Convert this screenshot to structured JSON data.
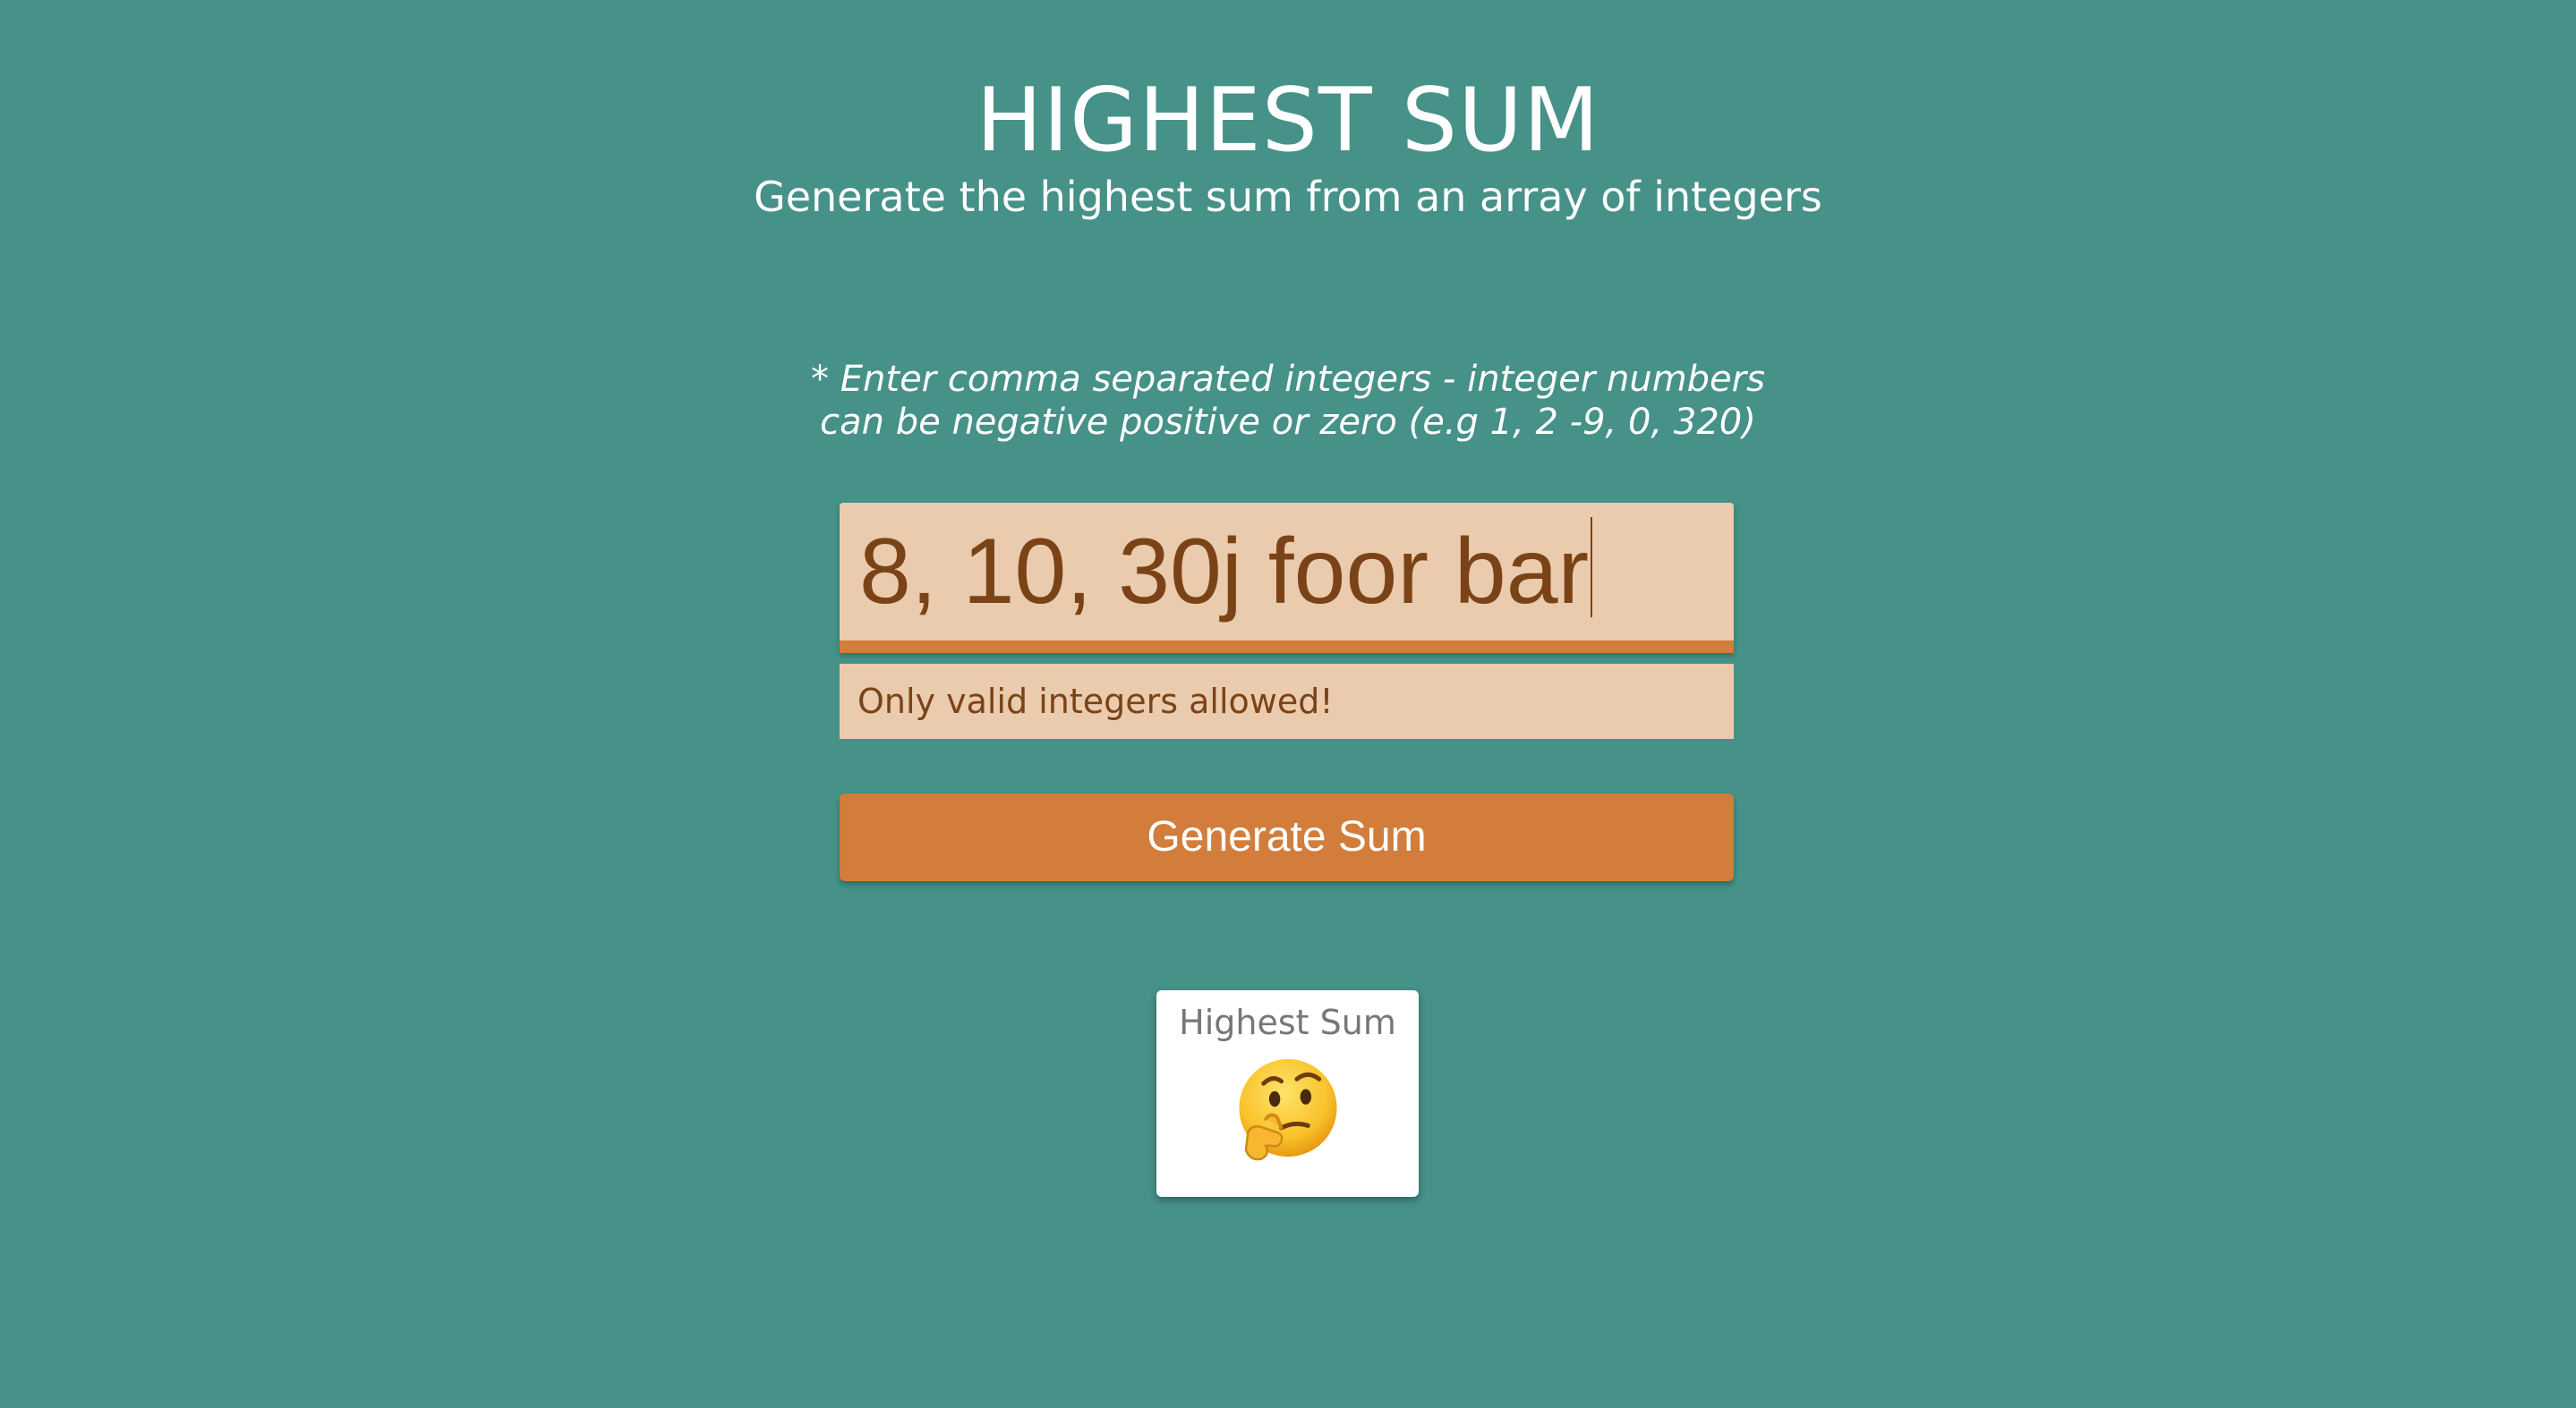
{
  "header": {
    "title": "HIGHEST SUM",
    "subtitle": "Generate the highest sum from an array of integers"
  },
  "form": {
    "hint_line1": "* Enter comma separated integers - integer numbers",
    "hint_line2": "can be negative positive or zero (e.g 1, 2 -9, 0, 320)",
    "input_value": "8, 10, 30j foor bar",
    "error_message": "Only valid integers allowed!",
    "submit_label": "Generate Sum"
  },
  "result": {
    "label": "Highest Sum",
    "icon": "thinking-face-emoji"
  },
  "colors": {
    "background": "#469188",
    "input_background": "#ebcbad",
    "accent": "#d27d3b",
    "input_text": "#7a4317"
  }
}
